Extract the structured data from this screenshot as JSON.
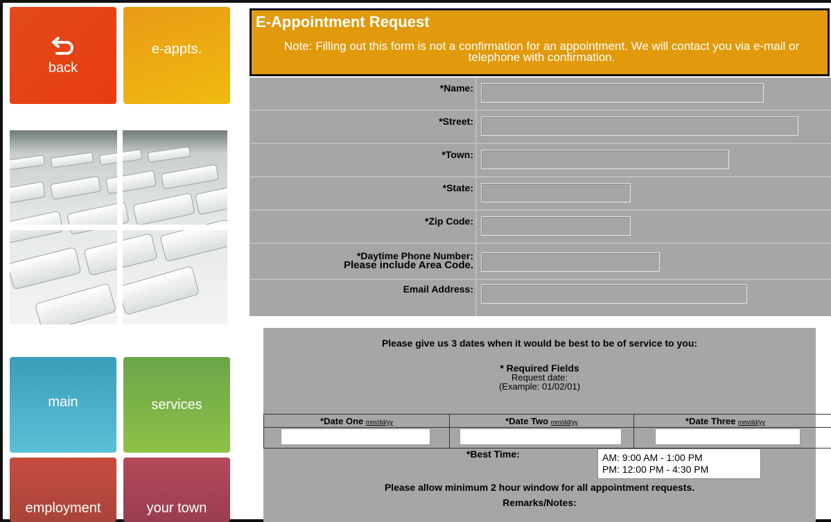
{
  "nav": {
    "back": "back",
    "eappts": "e-appts.",
    "main": "main",
    "services": "services",
    "employment": "employment",
    "your_town": "your town"
  },
  "banner": {
    "title": "E-Appointment Request",
    "note": "Note: Filling out this form is not a confirmation for an appointment. We will contact you via e-mail or telephone with confirmation."
  },
  "form": {
    "name_label": "*Name:",
    "street_label": "*Street:",
    "town_label": "*Town:",
    "state_label": "*State:",
    "zip_label": "*Zip Code:",
    "phone_label": "*Daytime Phone Number:",
    "phone_note": "Please include Area Code.",
    "email_label": "Email Address:"
  },
  "dates_section": {
    "instruction": "Please give us 3 dates when it would be best to be of service to you:",
    "required": "* Required Fields",
    "request_date": "Request date:",
    "example": "(Example: 01/02/01)",
    "date_one": "*Date One",
    "date_two": "*Date Two",
    "date_three": "*Date Three",
    "date_format": "mm/dd/yy",
    "best_time_label": "*Best Time:",
    "best_time_options": [
      "AM: 9:00 AM - 1:00 PM",
      "PM: 12:00 PM - 4:30 PM"
    ],
    "allow_note": "Please allow minimum 2 hour window for all appointment requests.",
    "remarks_label": "Remarks/Notes:"
  },
  "colors": {
    "back": "#e83c10",
    "eappts": "#f0bb0e",
    "main": "#4fb3cc",
    "services": "#7fb547",
    "employment": "#b9463c",
    "your_town": "#a64355",
    "banner": "#e19a0c",
    "form_bg": "#a6a6a6"
  }
}
